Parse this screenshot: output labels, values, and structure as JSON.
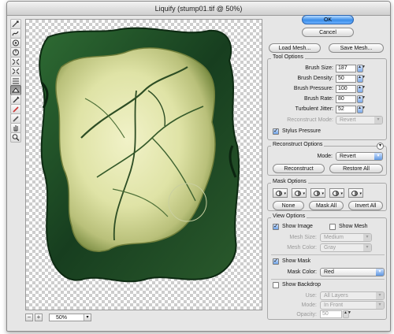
{
  "window": {
    "title": "Liquify (stump01.tif @ 50%)"
  },
  "toolbar": {
    "tools": [
      "warp-tool",
      "turbulence-tool",
      "twirl-cw-tool",
      "twirl-ccw-tool",
      "pucker-tool",
      "bloat-tool",
      "shift-pixels-tool",
      "reflection-tool",
      "reconstruct-tool",
      "freeze-tool",
      "thaw-tool",
      "hand-tool",
      "zoom-tool"
    ]
  },
  "status": {
    "zoom": "50%",
    "zoom_out": "−",
    "zoom_in": "+"
  },
  "buttons": {
    "ok": "OK",
    "cancel": "Cancel",
    "load_mesh": "Load Mesh...",
    "save_mesh": "Save Mesh..."
  },
  "tool_options": {
    "title": "Tool Options",
    "brush_size_label": "Brush Size:",
    "brush_size": "187",
    "brush_density_label": "Brush Density:",
    "brush_density": "50",
    "brush_pressure_label": "Brush Pressure:",
    "brush_pressure": "100",
    "brush_rate_label": "Brush Rate:",
    "brush_rate": "80",
    "turbulent_jitter_label": "Turbulent Jitter:",
    "turbulent_jitter": "52",
    "reconstruct_mode_label": "Reconstruct Mode:",
    "reconstruct_mode": "Revert",
    "stylus_pressure_label": "Stylus Pressure",
    "stylus_pressure": true
  },
  "reconstruct_options": {
    "title": "Reconstruct Options",
    "mode_label": "Mode:",
    "mode": "Revert",
    "reconstruct": "Reconstruct",
    "restore_all": "Restore All"
  },
  "mask_options": {
    "title": "Mask Options",
    "none": "None",
    "mask_all": "Mask All",
    "invert_all": "Invert All"
  },
  "view_options": {
    "title": "View Options",
    "show_image_label": "Show Image",
    "show_image": true,
    "show_mesh_label": "Show Mesh",
    "show_mesh": false,
    "mesh_size_label": "Mesh Size:",
    "mesh_size": "Medium",
    "mesh_color_label": "Mesh Color:",
    "mesh_color": "Gray",
    "show_mask_label": "Show Mask",
    "show_mask": true,
    "mask_color_label": "Mask Color:",
    "mask_color": "Red",
    "show_backdrop_label": "Show Backdrop",
    "show_backdrop": false,
    "use_label": "Use:",
    "use": "All Layers",
    "mode_label": "Mode:",
    "mode": "In Front",
    "opacity_label": "Opacity:",
    "opacity": "50"
  },
  "colors": {
    "accent": "#3b8de8",
    "panel": "#e6e6e6",
    "foliage_dark": "#173e1f",
    "wood_light": "#e4e8b0"
  }
}
